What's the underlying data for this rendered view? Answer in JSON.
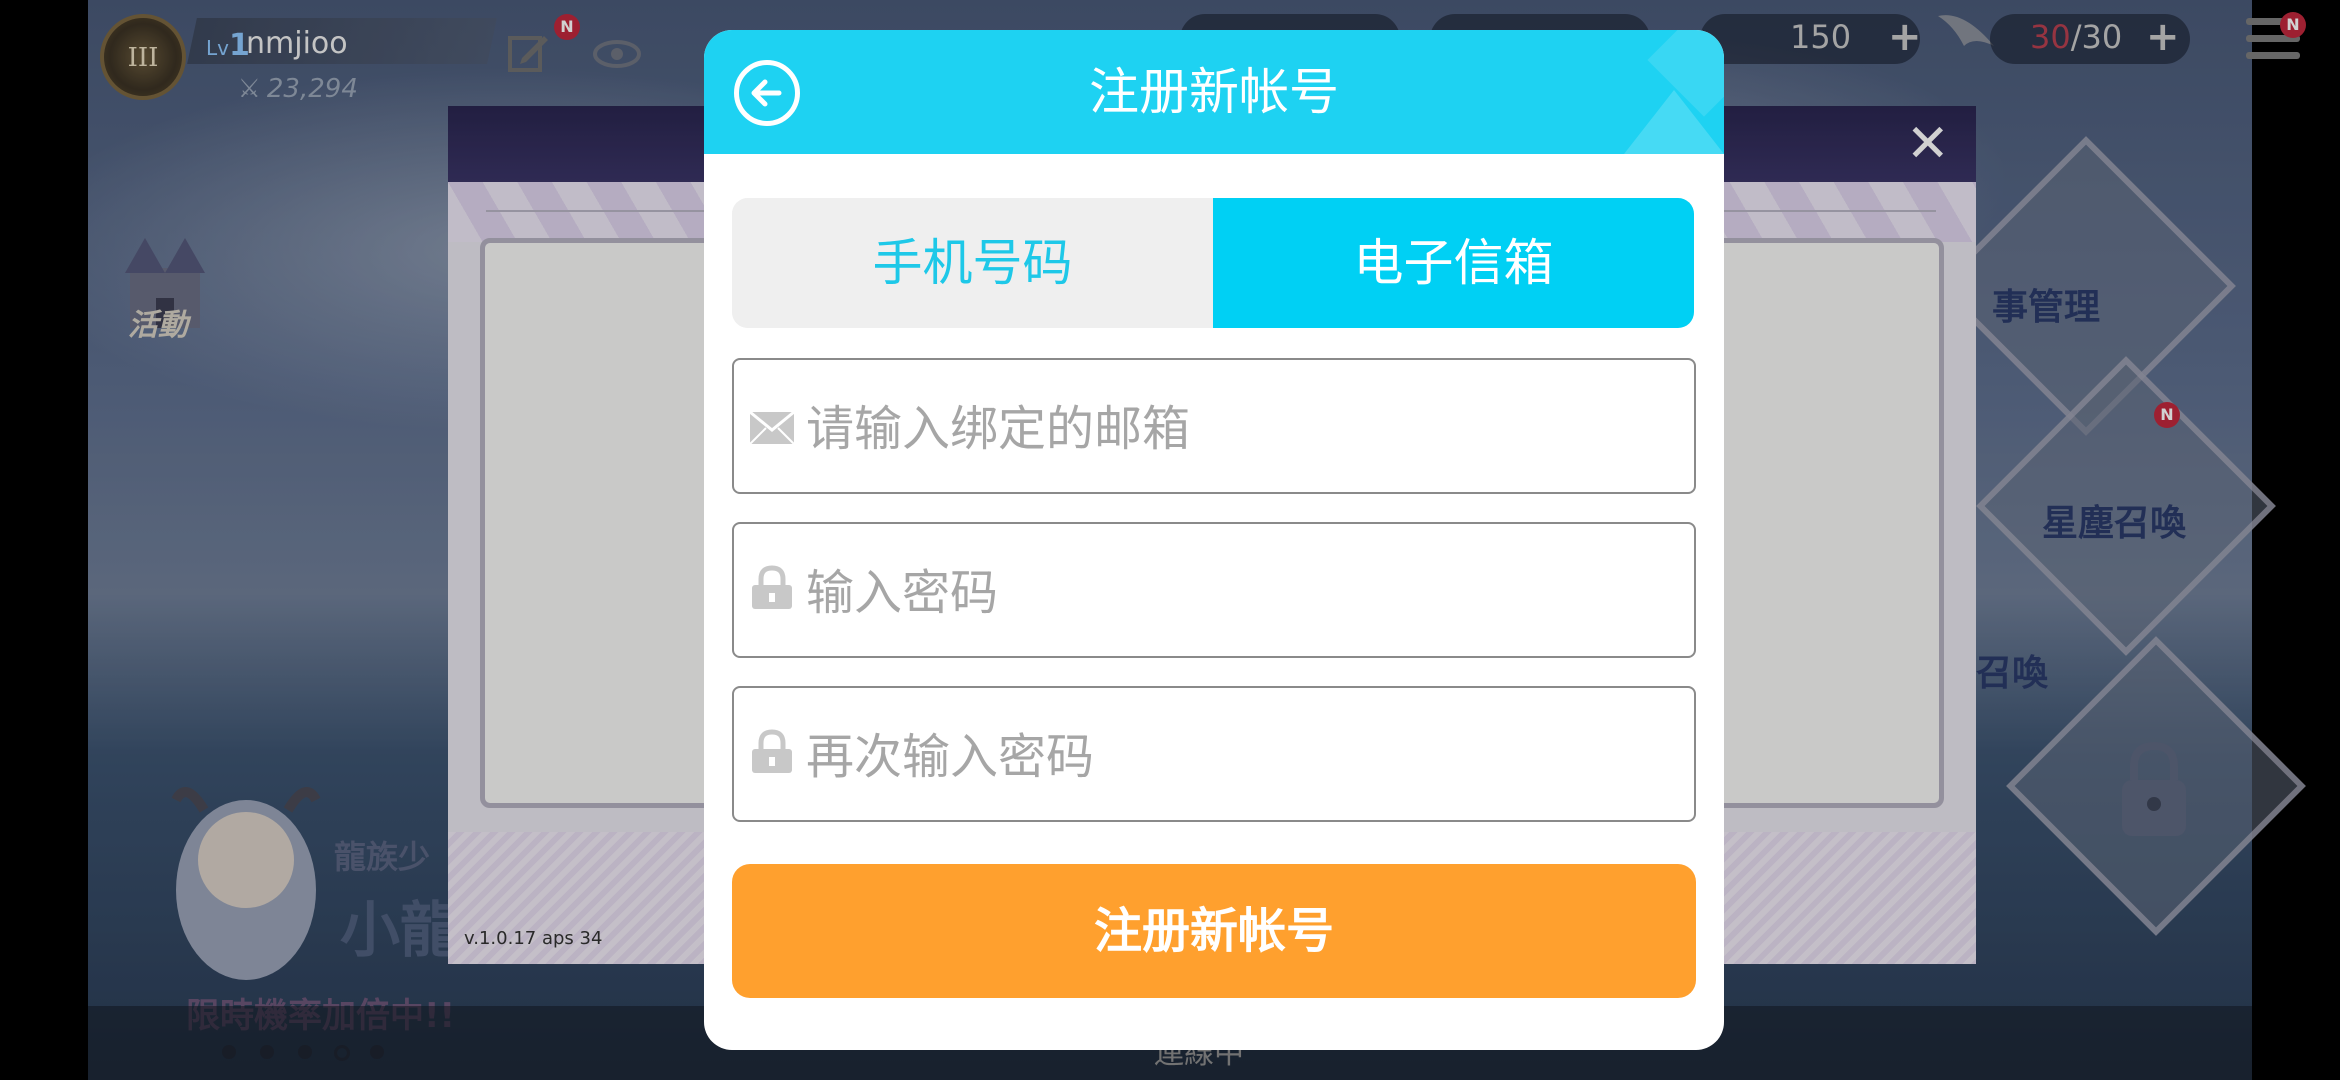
{
  "hud": {
    "rank_numeral": "III",
    "player_level_prefix": "Lv",
    "player_level": "1",
    "player_name": "nmjioo",
    "player_power": "23,294",
    "badge_new": "N",
    "resource_stamina_value": "150",
    "resource_energy_current": "30",
    "resource_energy_separator": "/",
    "resource_energy_max": "30",
    "plus_symbol": "+"
  },
  "background": {
    "event_label": "活動",
    "tile_management": "事管理",
    "tile_star_summon": "星塵召喚",
    "tile_summon": "召喚",
    "banner_line1": "龍族少",
    "banner_line2": "小龍",
    "banner_line3": "限時機率加倍中!!",
    "bottom_text": "連線中",
    "carousel_active_index": 3
  },
  "underlying_dialog": {
    "close_symbol": "✕",
    "version": "v.1.0.17 aps 34"
  },
  "modal": {
    "title": "注册新帐号",
    "back_icon": "arrow-left-circle-icon",
    "tabs": [
      {
        "label": "手机号码",
        "active": false
      },
      {
        "label": "电子信箱",
        "active": true
      }
    ],
    "fields": {
      "email": {
        "placeholder": "请输入绑定的邮箱",
        "value": "",
        "icon": "envelope-icon"
      },
      "password": {
        "placeholder": "输入密码",
        "value": "",
        "icon": "lock-icon"
      },
      "password_confirm": {
        "placeholder": "再次输入密码",
        "value": "",
        "icon": "lock-icon"
      }
    },
    "submit_label": "注册新帐号"
  },
  "colors": {
    "header_cyan": "#1ed2f2",
    "tab_active": "#00d0f4",
    "tab_inactive_text": "#1ec8e8",
    "submit_orange": "#ffa02e",
    "placeholder_gray": "#a6a6a6"
  }
}
